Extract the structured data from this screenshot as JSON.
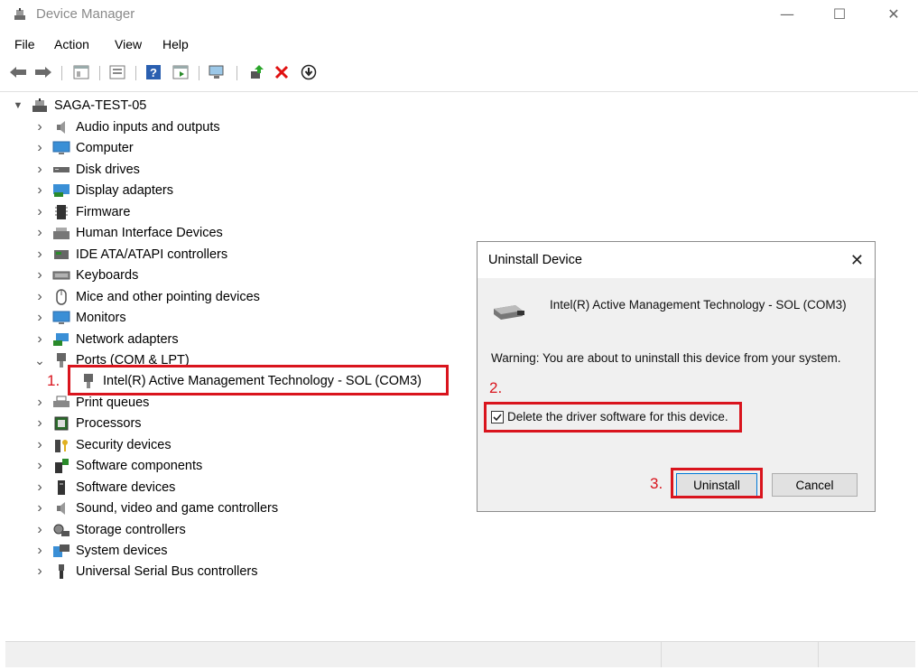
{
  "window": {
    "title": "Device Manager"
  },
  "menu": [
    "File",
    "Action",
    "View",
    "Help"
  ],
  "tree": {
    "root": "SAGA-TEST-05",
    "items": [
      {
        "label": "Audio inputs and outputs",
        "icon": "speaker-icon"
      },
      {
        "label": "Computer",
        "icon": "computer-icon"
      },
      {
        "label": "Disk drives",
        "icon": "disk-drive-icon"
      },
      {
        "label": "Display adapters",
        "icon": "display-adapter-icon"
      },
      {
        "label": "Firmware",
        "icon": "firmware-icon"
      },
      {
        "label": "Human Interface Devices",
        "icon": "hid-icon"
      },
      {
        "label": "IDE ATA/ATAPI controllers",
        "icon": "ide-controller-icon"
      },
      {
        "label": "Keyboards",
        "icon": "keyboard-icon"
      },
      {
        "label": "Mice and other pointing devices",
        "icon": "mouse-icon"
      },
      {
        "label": "Monitors",
        "icon": "monitor-icon"
      },
      {
        "label": "Network adapters",
        "icon": "network-adapter-icon"
      },
      {
        "label": "Ports (COM & LPT)",
        "icon": "port-icon"
      },
      {
        "label": "Intel(R) Active Management Technology - SOL (COM3)",
        "icon": "port-device-icon"
      },
      {
        "label": "Print queues",
        "icon": "printer-icon"
      },
      {
        "label": "Processors",
        "icon": "processor-icon"
      },
      {
        "label": "Security devices",
        "icon": "security-icon"
      },
      {
        "label": "Software components",
        "icon": "software-component-icon"
      },
      {
        "label": "Software devices",
        "icon": "software-device-icon"
      },
      {
        "label": "Sound, video and game controllers",
        "icon": "sound-icon"
      },
      {
        "label": "Storage controllers",
        "icon": "storage-icon"
      },
      {
        "label": "System devices",
        "icon": "system-devices-icon"
      },
      {
        "label": "Universal Serial Bus controllers",
        "icon": "usb-icon"
      }
    ]
  },
  "dialog": {
    "title": "Uninstall Device",
    "device_name": "Intel(R) Active Management Technology - SOL (COM3)",
    "warning": "Warning: You are about to uninstall this device from your system.",
    "checkbox_label": "Delete the driver software for this device.",
    "checkbox_checked": true,
    "uninstall_label": "Uninstall",
    "cancel_label": "Cancel"
  },
  "annotations": {
    "step1": "1.",
    "step2": "2.",
    "step3": "3.",
    "color": "#d9141d"
  }
}
